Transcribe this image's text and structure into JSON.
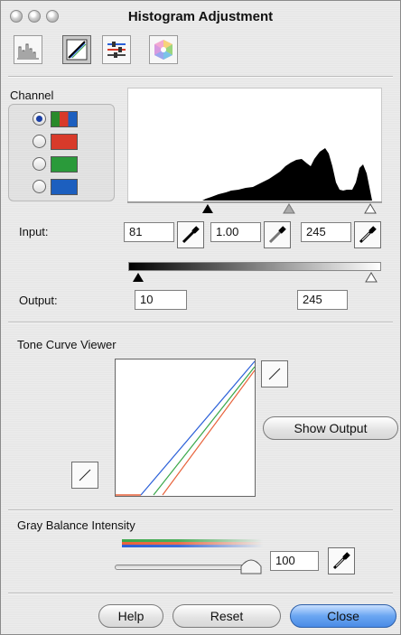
{
  "window": {
    "title": "Histogram Adjustment"
  },
  "toolbar": {
    "buttons": [
      {
        "icon": "histogram-icon"
      },
      {
        "icon": "curves-icon"
      },
      {
        "icon": "levels-icon"
      },
      {
        "icon": "color-wheel-icon"
      }
    ],
    "active_index": 1
  },
  "channel": {
    "label": "Channel",
    "options": [
      {
        "id": "rgb",
        "colors": [
          "#2a8a2a",
          "#d83a2a",
          "#1c5fbf"
        ],
        "selected": true
      },
      {
        "id": "red",
        "colors": [
          "#d83a2a"
        ],
        "selected": false
      },
      {
        "id": "green",
        "colors": [
          "#2a9a3a"
        ],
        "selected": false
      },
      {
        "id": "blue",
        "colors": [
          "#1c5fbf"
        ],
        "selected": false
      }
    ]
  },
  "input": {
    "label": "Input:",
    "black": "81",
    "gamma": "1.00",
    "white": "245",
    "black_slider": 81,
    "gamma_slider_pos": 0.5,
    "white_slider": 245
  },
  "output": {
    "label": "Output:",
    "black": "10",
    "white": "245",
    "black_slider": 10,
    "white_slider": 245
  },
  "tone_curve": {
    "label": "Tone Curve Viewer",
    "show_output_label": "Show Output"
  },
  "gray_balance": {
    "label": "Gray Balance Intensity",
    "value": "100"
  },
  "buttons": {
    "help": "Help",
    "reset": "Reset",
    "close": "Close"
  },
  "colors": {
    "red": "#e8623a",
    "green": "#3aa84a",
    "blue": "#2a5fd8",
    "accent": "#5a9af0"
  }
}
